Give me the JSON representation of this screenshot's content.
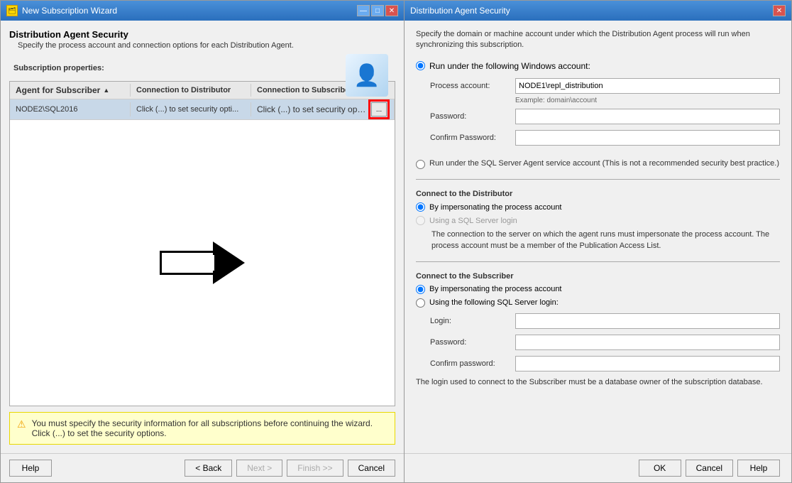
{
  "leftWindow": {
    "titleBar": {
      "icon": "🗂",
      "title": "New Subscription Wizard",
      "btnMin": "—",
      "btnMax": "□",
      "btnClose": "✕"
    },
    "heading": "Distribution Agent Security",
    "description": "Specify the process account and connection options for each Distribution Agent.",
    "subscriptionLabel": "Subscription properties:",
    "tableHeaders": {
      "col1": "Agent for Subscriber",
      "col2": "Connection to Distributor",
      "col3": "Connection to Subscriber"
    },
    "tableRow": {
      "col1": "NODE2\\SQL2016",
      "col2": "Click (...) to set security opti...",
      "col3": "Click (...) to set security opti...",
      "ellipsis": "..."
    },
    "warning": "You must specify the security information for all subscriptions before continuing the wizard. Click (...) to set the security options.",
    "buttons": {
      "help": "Help",
      "back": "< Back",
      "next": "Next >",
      "finish": "Finish >>",
      "cancel": "Cancel"
    }
  },
  "rightWindow": {
    "titleBar": {
      "title": "Distribution Agent Security",
      "btnClose": "✕"
    },
    "description": "Specify the domain or machine account under which the Distribution Agent process will run when synchronizing this subscription.",
    "runUnderWindowsAccount": "Run under the following Windows account:",
    "processAccount": {
      "label": "Process account:",
      "value": "NODE1\\repl_distribution",
      "hint": "Example: domain\\account"
    },
    "password": {
      "label": "Password:",
      "value": ""
    },
    "confirmPassword": {
      "label": "Confirm Password:",
      "value": ""
    },
    "runUnderSQLAgent": "Run under the SQL Server Agent service account (This is not a recommended security best practice.)",
    "connectDistributor": {
      "title": "Connect to the Distributor",
      "option1": "By impersonating the process account",
      "option2": "Using a SQL Server login",
      "info": "The connection to the server on which the agent runs must impersonate the process account. The process account must be a member of the Publication Access List."
    },
    "connectSubscriber": {
      "title": "Connect to the Subscriber",
      "option1": "By impersonating the process account",
      "option2": "Using the following SQL Server login:",
      "login": {
        "label": "Login:",
        "value": ""
      },
      "password": {
        "label": "Password:",
        "value": ""
      },
      "confirmPassword": {
        "label": "Confirm password:",
        "value": ""
      },
      "hint": "The login used to connect to the Subscriber must be a database owner of the subscription database."
    },
    "buttons": {
      "ok": "OK",
      "cancel": "Cancel",
      "help": "Help"
    }
  }
}
